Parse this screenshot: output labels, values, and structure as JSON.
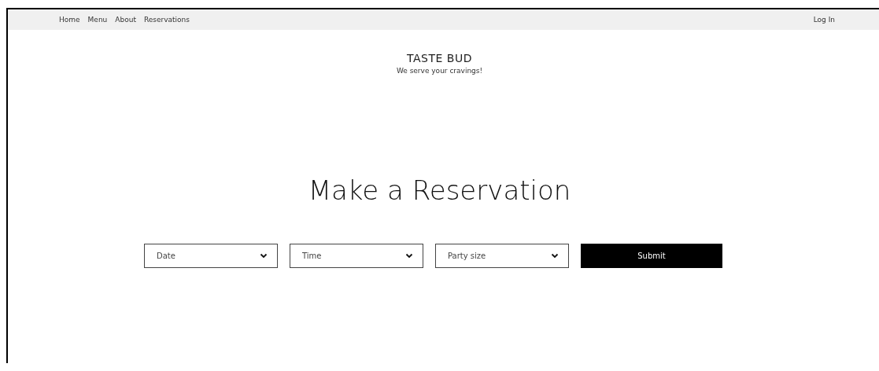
{
  "nav": {
    "links": [
      {
        "label": "Home"
      },
      {
        "label": "Menu"
      },
      {
        "label": "About"
      },
      {
        "label": "Reservations"
      }
    ],
    "login": "Log In"
  },
  "header": {
    "title": "TASTE BUD",
    "tagline": "We serve your cravings!"
  },
  "heading": "Make a Reservation",
  "form": {
    "fields": [
      {
        "placeholder": "Date"
      },
      {
        "placeholder": "Time"
      },
      {
        "placeholder": "Party size"
      }
    ],
    "submit": "Submit"
  }
}
